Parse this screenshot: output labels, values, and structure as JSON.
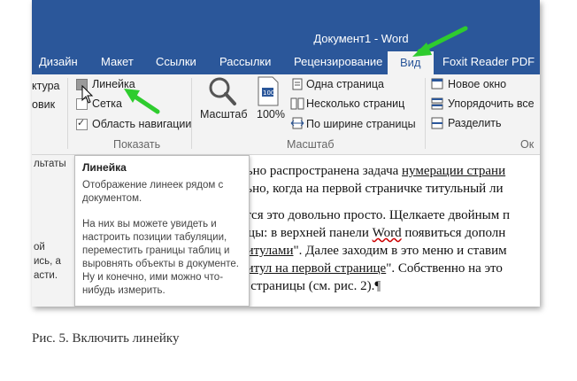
{
  "title": "Документ1 - Word",
  "tabs": [
    "Дизайн",
    "Макет",
    "Ссылки",
    "Рассылки",
    "Рецензирование",
    "Вид",
    "Foxit Reader PDF"
  ],
  "ribbon": {
    "left_cut": [
      "ктура",
      "овик"
    ],
    "show_group": {
      "items": [
        {
          "label": "Линейка",
          "checked": false
        },
        {
          "label": "Сетка",
          "checked": false
        },
        {
          "label": "Область навигации",
          "checked": true
        }
      ],
      "name": "Показать"
    },
    "zoom_group": {
      "zoom_label": "Масштаб",
      "percent_label": "100%",
      "one_page": "Одна страница",
      "multi_page": "Несколько страниц",
      "page_width": "По ширине страницы",
      "name": "Масштаб"
    },
    "window_group": {
      "new_window": "Новое окно",
      "arrange_all": "Упорядочить все",
      "split": "Разделить",
      "name_cut": "Ок"
    }
  },
  "left_pane": [
    "льтаты",
    "ой",
    "ись, а",
    "асти."
  ],
  "tooltip": {
    "title": "Линейка",
    "p1": "Отображение линеек рядом с документом.",
    "p2": "На них вы можете увидеть и настроить позиции табуляции, переместить границы таблиц и выровнять объекты в документе. Ну и конечно, ими можно что-нибудь измерить."
  },
  "doc_lines": [
    {
      "pre": "ольно распространена задача ",
      "link": "нумерации страни",
      "post": ""
    },
    {
      "pre": "ально, когда на первой страничке титульный ли",
      "link": "",
      "post": ""
    },
    {
      "pre": "ается это довольно просто. Щелкаете двойным п",
      "link": "",
      "post": ""
    },
    {
      "pre": "ницы: в верхней панели ",
      "link": "Word",
      "post": " появиться дополн"
    },
    {
      "pre": "нтитулами",
      "link": "",
      "post": "\". Далее заходим в это меню и ставим"
    },
    {
      "pre": "нтитул на первой странице",
      "link": "",
      "post": "\". Собственно на это"
    },
    {
      "pre": "ой страницы (см. рис. 2).¶",
      "link": "",
      "post": ""
    }
  ],
  "caption": "Рис. 5. Включить линейку",
  "colors": {
    "word_blue": "#2b579a",
    "ribbon_bg": "#f3f3f3",
    "arrow_green": "#2ecc2e"
  }
}
